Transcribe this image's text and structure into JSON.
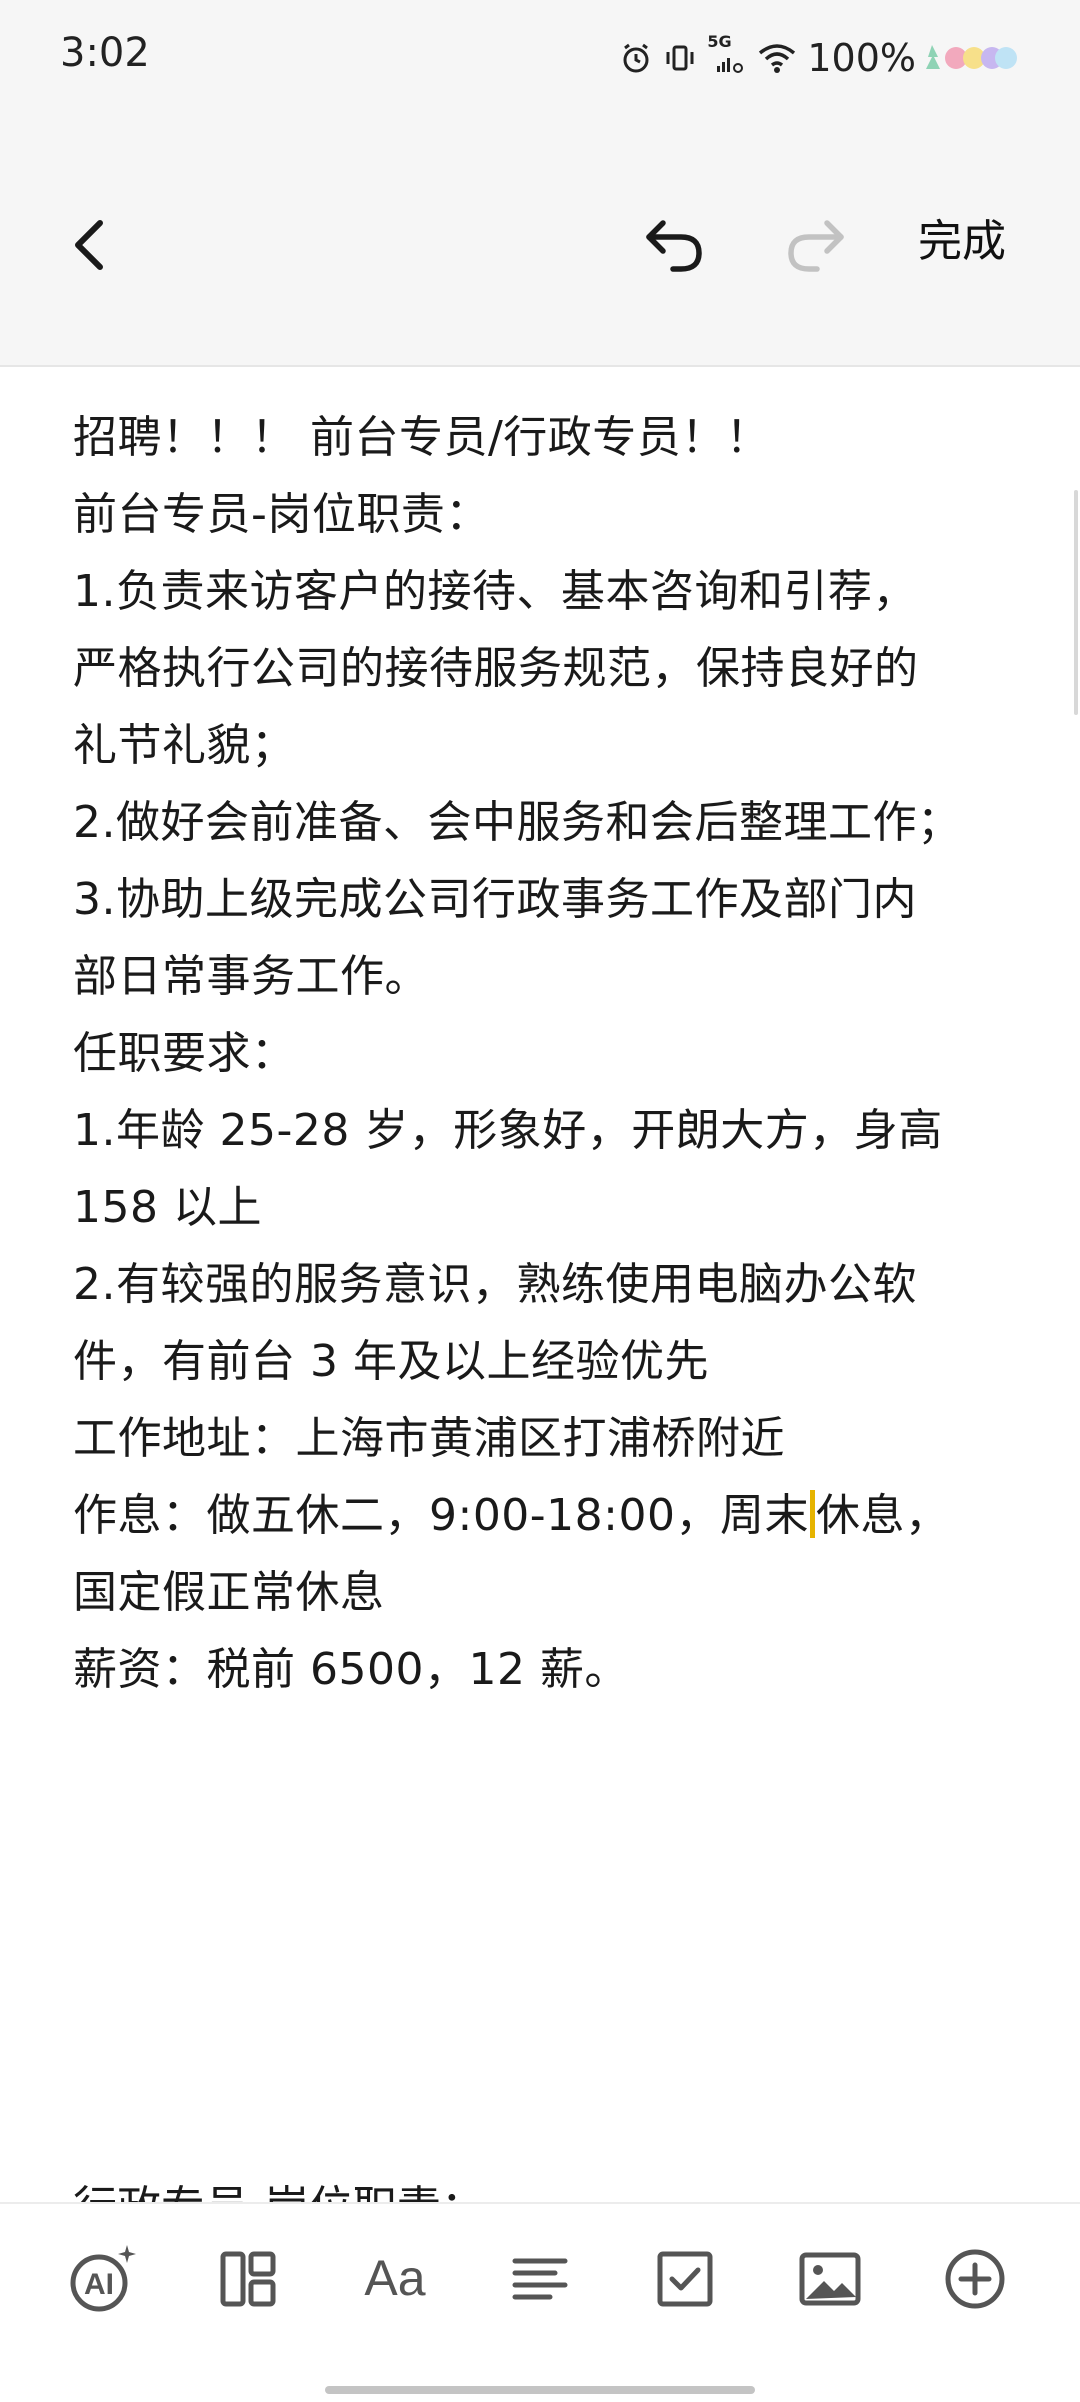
{
  "status": {
    "time": "3:02",
    "network": "5G",
    "battery": "100%"
  },
  "header": {
    "done_label": "完成"
  },
  "note": {
    "lines": [
      "招聘！！！ 前台专员/行政专员！！",
      "前台专员-岗位职责：",
      "1.负责来访客户的接待、基本咨询和引荐，",
      "严格执行公司的接待服务规范，保持良好的",
      "礼节礼貌；",
      "2.做好会前准备、会中服务和会后整理工作；",
      "3.协助上级完成公司行政事务工作及部门内",
      "部日常事务工作。",
      "任职要求：",
      "1.年龄 25-28 岁，形象好，开朗大方，身高",
      "158 以上",
      "2.有较强的服务意识，熟练使用电脑办公软",
      "件，有前台 3 年及以上经验优先",
      "工作地址：上海市黄浦区打浦桥附近"
    ],
    "rest_before_cursor": "作息：做五休二，9:00-18:00，周末",
    "rest_after_cursor": "休息，",
    "rest_line2": "国定假正常休息",
    "salary": "薪资：税前 6500，12 薪。",
    "peek": "行政专员-岗位职责："
  },
  "toolbar": {
    "items": [
      "ai-icon",
      "layout-icon",
      "text-format-icon",
      "paragraph-icon",
      "checklist-icon",
      "image-icon",
      "add-icon"
    ]
  },
  "colors": {
    "cursor": "#e6b400",
    "header_bg": "#f6f6f6"
  }
}
